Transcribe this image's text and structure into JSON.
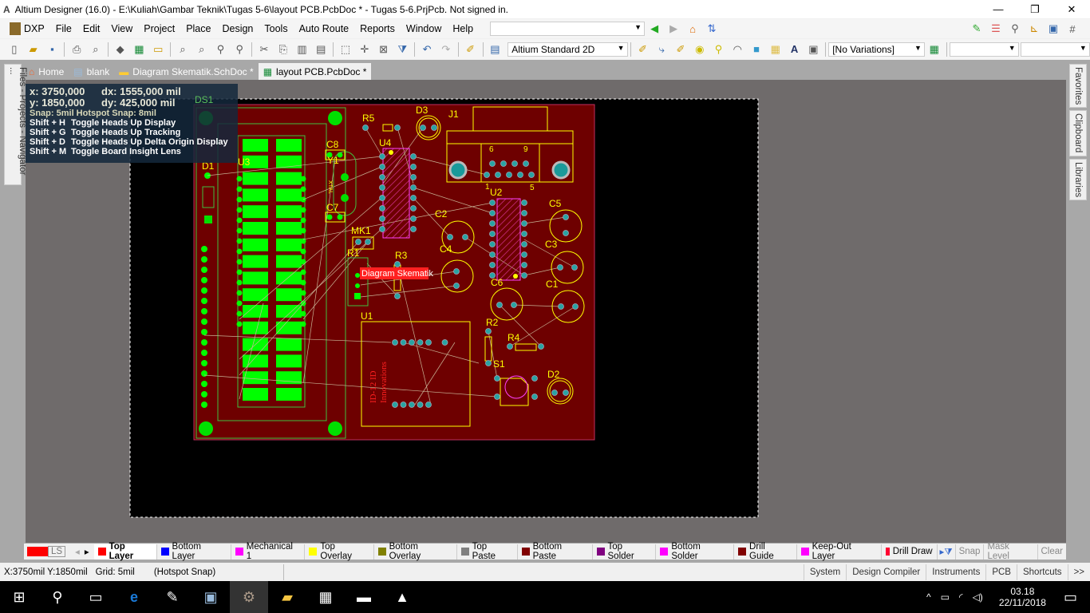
{
  "window": {
    "title": "Altium Designer (16.0) - E:\\Kuliah\\Gambar Teknik\\Tugas 5-6\\layout PCB.PcbDoc * - Tugas 5-6.PrjPcb. Not signed in.",
    "minimize": "—",
    "maximize": "❐",
    "close": "✕"
  },
  "menu": [
    "DXP",
    "File",
    "Edit",
    "View",
    "Project",
    "Place",
    "Design",
    "Tools",
    "Auto Route",
    "Reports",
    "Window",
    "Help"
  ],
  "toolbar": {
    "view_config": "Altium Standard 2D",
    "variations": "[No Variations]",
    "path_combo": "",
    "combo_a": "",
    "combo_b": ""
  },
  "left_panel": "Files - Projects - Navigator ...",
  "right_panels": [
    "Favorites",
    "Clipboard",
    "Libraries"
  ],
  "doc_tabs": [
    {
      "label": "Home",
      "icon": "home-icon"
    },
    {
      "label": "blank",
      "icon": "document-icon"
    },
    {
      "label": "Diagram Skematik.SchDoc *",
      "icon": "schematic-icon"
    },
    {
      "label": "layout PCB.PcbDoc *",
      "icon": "pcb-icon",
      "active": true
    }
  ],
  "hud": {
    "x": "x:  3750,000",
    "dx": "dx:  1555,000  mil",
    "y": "y:  1850,000",
    "dy": "dy:   425,000   mil",
    "snap": "Snap: 5mil Hotspot Snap: 8mil",
    "shortcuts": [
      [
        "Shift + H",
        "Toggle Heads Up Display"
      ],
      [
        "Shift + G",
        "Toggle Heads Up Tracking"
      ],
      [
        "Shift + D",
        "Toggle Heads Up Delta Origin Display"
      ],
      [
        "Shift + M",
        "Toggle Board Insight Lens"
      ]
    ]
  },
  "pcb": {
    "designators": {
      "DS1": "DS1",
      "D1": "D1",
      "U3": "U3",
      "C8": "C8",
      "Y1": "Y1",
      "C7": "C7",
      "R5": "R5",
      "D3": "D3",
      "J1": "J1",
      "U4": "U4",
      "MK1": "MK1",
      "R1": "R1",
      "R3": "R3",
      "C2": "C2",
      "C4": "C4",
      "U2": "U2",
      "C5": "C5",
      "C3": "C3",
      "C6": "C6",
      "C1": "C1",
      "U1": "U1",
      "R2": "R2",
      "R4": "R4",
      "S1": "S1",
      "D2": "D2"
    },
    "j1_pins": [
      "6",
      "9",
      "1",
      "5"
    ],
    "xtal": "XTAL",
    "u1_text": [
      "ID-12 ID",
      "Innovations"
    ],
    "tooltip": "Diagram Skematik",
    "colors": {
      "board": "#6e0000",
      "overlay": "#ffff00",
      "top_layer": "#00ff00",
      "pad": "#2aa3a3",
      "ratsnest": "#c8b496",
      "mech": "#ff40ff"
    }
  },
  "layers": {
    "current": "LS",
    "current_color": "#ff0000",
    "tabs": [
      {
        "label": "Top Layer",
        "color": "#ff0000",
        "active": true
      },
      {
        "label": "Bottom Layer",
        "color": "#0000ff"
      },
      {
        "label": "Mechanical 1",
        "color": "#ff00ff"
      },
      {
        "label": "Top Overlay",
        "color": "#ffff00"
      },
      {
        "label": "Bottom Overlay",
        "color": "#808000"
      },
      {
        "label": "Top Paste",
        "color": "#808080"
      },
      {
        "label": "Bottom Paste",
        "color": "#800000"
      },
      {
        "label": "Top Solder",
        "color": "#800080"
      },
      {
        "label": "Bottom Solder",
        "color": "#ff00ff"
      },
      {
        "label": "Drill Guide",
        "color": "#800000"
      },
      {
        "label": "Keep-Out Layer",
        "color": "#ff00ff"
      },
      {
        "label": "Drill Draw",
        "color": "#ff0030"
      }
    ],
    "buttons": [
      "Snap",
      "Mask Level",
      "Clear"
    ]
  },
  "status": {
    "coords": "X:3750mil Y:1850mil",
    "grid": "Grid: 5mil",
    "snap": "(Hotspot Snap)",
    "panels": [
      "System",
      "Design Compiler",
      "Instruments",
      "PCB",
      "Shortcuts",
      ">>"
    ]
  },
  "taskbar": {
    "time": "03.18",
    "date": "22/11/2018"
  }
}
